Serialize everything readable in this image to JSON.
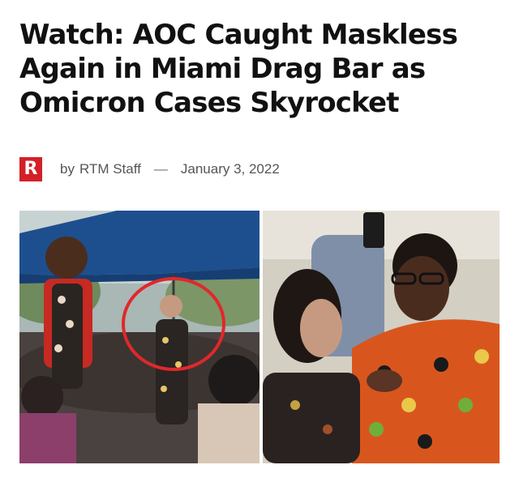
{
  "article": {
    "headline": "Watch: AOC Caught Maskless Again in Miami Drag Bar as Omicron Cases Skyrocket",
    "byline": {
      "logo_letter": "R",
      "prefix": "by",
      "author": "RTM Staff",
      "separator": "—",
      "date": "January 3, 2022"
    },
    "colors": {
      "brand": "#d32027",
      "highlight_circle": "#e0282b"
    }
  }
}
